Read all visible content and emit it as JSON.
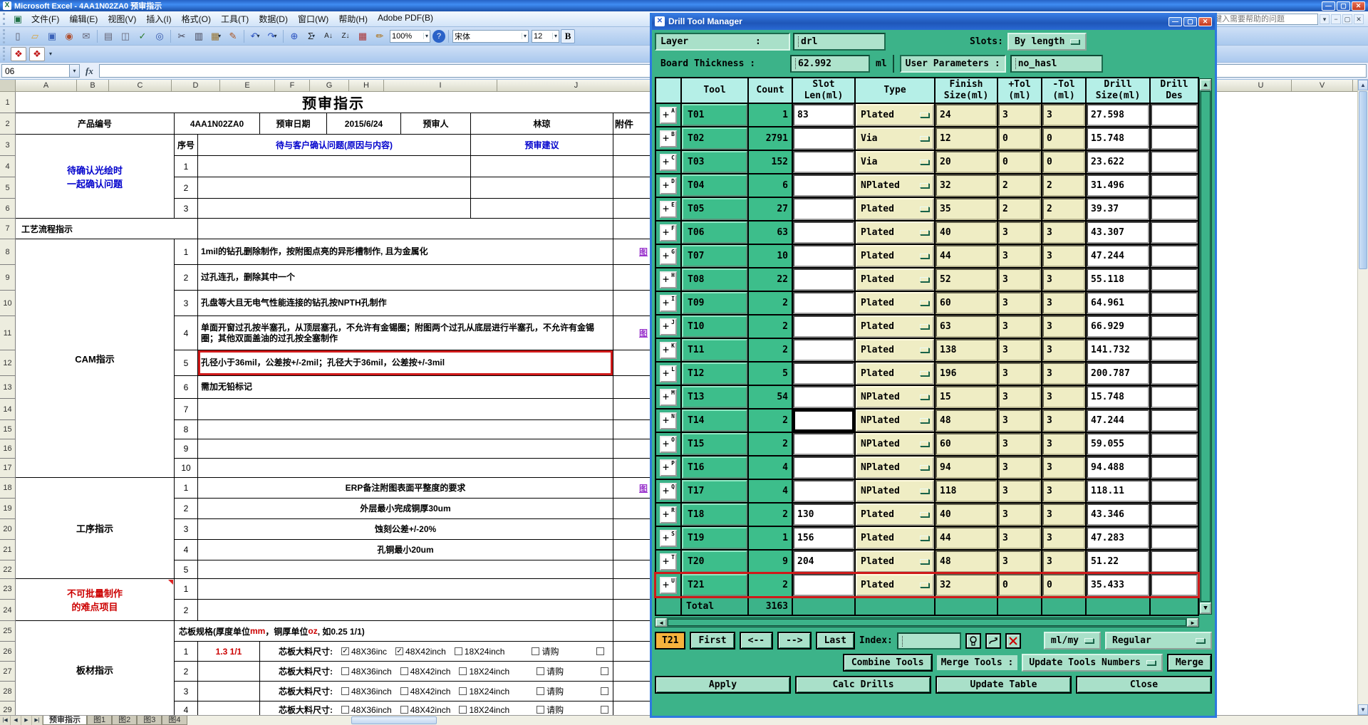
{
  "colors": {
    "dialog_green": "#3cb389",
    "panel_green": "#a9e0c9",
    "header_cyan": "#b5efe7",
    "field_khaki": "#efedc4",
    "highlight_red": "#cf1a1a",
    "current_orange": "#f6b33d",
    "link_blue": "#0000cc",
    "alert_red": "#cc0000",
    "titlebar_blue": "#2663c5"
  },
  "excel": {
    "title_bar": {
      "title": "Microsoft Excel - 4AA1N02ZA0 预审指示"
    },
    "menu_bar": {
      "items": [
        "文件(F)",
        "编辑(E)",
        "视图(V)",
        "插入(I)",
        "格式(O)",
        "工具(T)",
        "数据(D)",
        "窗口(W)",
        "帮助(H)",
        "Adobe PDF(B)"
      ],
      "help_placeholder": "键入需要帮助的问题",
      "window_controls": [
        "−",
        "▢",
        "✕"
      ]
    },
    "toolbar": {
      "zoom_value": "100%",
      "font_name": "宋体",
      "font_size": "12",
      "bold_label": "B",
      "icons": [
        {
          "name": "new-icon",
          "glyph": "▯",
          "color": "#556"
        },
        {
          "name": "open-icon",
          "glyph": "▱",
          "color": "#d9a43a"
        },
        {
          "name": "save-icon",
          "glyph": "▣",
          "color": "#3a62b8"
        },
        {
          "name": "permission-icon",
          "glyph": "◉",
          "color": "#b05030"
        },
        {
          "name": "email-icon",
          "glyph": "✉",
          "color": "#667"
        },
        {
          "sep": true
        },
        {
          "name": "print-icon",
          "glyph": "▤",
          "color": "#667"
        },
        {
          "name": "print-preview-icon",
          "glyph": "◫",
          "color": "#667"
        },
        {
          "name": "spelling-icon",
          "glyph": "✓",
          "color": "#2a7a2a"
        },
        {
          "name": "research-icon",
          "glyph": "◎",
          "color": "#3355aa"
        },
        {
          "sep": true
        },
        {
          "name": "cut-icon",
          "glyph": "✂",
          "color": "#445"
        },
        {
          "name": "copy-icon",
          "glyph": "▥",
          "color": "#445"
        },
        {
          "name": "paste-icon",
          "glyph": "▦",
          "color": "#997633",
          "dd": true
        },
        {
          "name": "format-painter-icon",
          "glyph": "✎",
          "color": "#aa5522"
        },
        {
          "sep": true
        },
        {
          "name": "undo-icon",
          "glyph": "↶",
          "color": "#2a52c0",
          "dd": true
        },
        {
          "name": "redo-icon",
          "glyph": "↷",
          "color": "#2a52c0",
          "dd": true
        },
        {
          "sep": true
        },
        {
          "name": "hyperlink-icon",
          "glyph": "⊕",
          "color": "#2a52c0"
        },
        {
          "name": "autosum-icon",
          "glyph": "Σ",
          "color": "#222",
          "dd": true
        },
        {
          "name": "sort-asc-icon",
          "glyph": "A↓",
          "color": "#222"
        },
        {
          "name": "sort-desc-icon",
          "glyph": "Z↓",
          "color": "#222"
        },
        {
          "name": "chart-wizard-icon",
          "glyph": "▦",
          "color": "#aa3333"
        },
        {
          "name": "drawing-icon",
          "glyph": "✏",
          "color": "#aa6600"
        }
      ],
      "pdf_icons": [
        {
          "name": "convert-to-pdf-icon",
          "glyph": "❖"
        },
        {
          "name": "convert-to-pdf-email-icon",
          "glyph": "❖"
        }
      ]
    },
    "formula_bar": {
      "name_box": "06",
      "fx_label": "fx",
      "formula_value": ""
    },
    "column_headers": [
      "A",
      "B",
      "C",
      "D",
      "E",
      "F",
      "G",
      "H",
      "I",
      "J"
    ],
    "right_column_headers": [
      "U",
      "V"
    ],
    "tab_nav": [
      "|◀",
      "◀",
      "▶",
      "▶|"
    ],
    "tabs": [
      {
        "label": "预审指示",
        "active": true
      },
      {
        "label": "图1",
        "active": false
      },
      {
        "label": "图2",
        "active": false
      },
      {
        "label": "图3",
        "active": false
      },
      {
        "label": "图4",
        "active": false
      }
    ],
    "sheet": {
      "r1_title": "预审指示",
      "r2": {
        "product_label": "产品编号",
        "product_value": "4AA1N02ZA0",
        "date_label": "预审日期",
        "date_value": "2015/6/24",
        "reviewer_label": "预审人",
        "reviewer_value": "林琼",
        "attach_label": "附件"
      },
      "confirm_group": {
        "label1": "待确认光绘时",
        "label2": "一起确认问题",
        "seq_label": "序号",
        "question_header": "待与客户确认问题(原因与内容)",
        "advice_header": "预审建议",
        "seq": [
          "1",
          "2",
          "3"
        ]
      },
      "r7_label": "工艺流程指示",
      "attach_glyph": "图",
      "cam_group": {
        "label": "CAM指示",
        "items": [
          {
            "n": "1",
            "text": "1mil的钻孔删除制作，按附图点亮的异形槽制作, 且为金属化",
            "link": true
          },
          {
            "n": "2",
            "text": "过孔连孔，删除其中一个"
          },
          {
            "n": "3",
            "text": "孔盘等大且无电气性能连接的钻孔按NPTH孔制作"
          },
          {
            "n": "4",
            "text": "单面开窗过孔按半塞孔，从顶层塞孔，不允许有金锡圈；附图两个过孔从底层进行半塞孔，不允许有金锡圈；其他双面盖油的过孔按全塞制作",
            "link": true
          },
          {
            "n": "5",
            "text": "孔径小于36mil，公差按+/-2mil；孔径大于36mil，公差按+/-3mil",
            "boxed": true
          },
          {
            "n": "6",
            "text": "需加无铅标记"
          },
          {
            "n": "7",
            "text": ""
          },
          {
            "n": "8",
            "text": ""
          },
          {
            "n": "9",
            "text": ""
          },
          {
            "n": "10",
            "text": ""
          }
        ]
      },
      "process_group": {
        "label": "工序指示",
        "items": [
          {
            "n": "1",
            "text": "ERP备注附图表面平整度的要求",
            "link": true
          },
          {
            "n": "2",
            "text": "外层最小完成铜厚30um"
          },
          {
            "n": "3",
            "text": "蚀刻公差+/-20%"
          },
          {
            "n": "4",
            "text": "孔铜最小20um"
          },
          {
            "n": "5",
            "text": ""
          }
        ]
      },
      "difficult_group": {
        "label1": "不可批量制作",
        "label2": "的难点项目",
        "items": [
          {
            "n": "1"
          },
          {
            "n": "2"
          }
        ]
      },
      "board_group": {
        "label": "板材指示",
        "header_parts": [
          {
            "t": "芯板规格(厚度单位",
            "red": false
          },
          {
            "t": "mm",
            "red": true
          },
          {
            "t": "，铜厚单位",
            "red": false
          },
          {
            "t": "oz",
            "red": true
          },
          {
            "t": ", 如0.25 1/1)",
            "red": false
          }
        ],
        "rows": [
          {
            "n": "1",
            "value": "1.3 1/1",
            "label": "芯板大料尺寸:",
            "checks": [
              {
                "label": "48X36inc",
                "checked": true
              },
              {
                "label": "48X42inch",
                "checked": true
              },
              {
                "label": "18X24inch",
                "checked": false
              },
              {
                "label": "请购",
                "checked": false
              },
              {
                "label": "",
                "checked": false
              }
            ]
          },
          {
            "n": "2",
            "value": "",
            "label": "芯板大料尺寸:",
            "checks": [
              {
                "label": "48X36inch",
                "checked": false
              },
              {
                "label": "48X42inch",
                "checked": false
              },
              {
                "label": "18X24inch",
                "checked": false
              },
              {
                "label": "请购",
                "checked": false
              },
              {
                "label": "",
                "checked": false
              }
            ]
          },
          {
            "n": "3",
            "value": "",
            "label": "芯板大料尺寸:",
            "checks": [
              {
                "label": "48X36inch",
                "checked": false
              },
              {
                "label": "48X42inch",
                "checked": false
              },
              {
                "label": "18X24inch",
                "checked": false
              },
              {
                "label": "请购",
                "checked": false
              },
              {
                "label": "",
                "checked": false
              }
            ]
          },
          {
            "n": "4",
            "value": "",
            "label": "芯板大料尺寸:",
            "checks": [
              {
                "label": "48X36inch",
                "checked": false
              },
              {
                "label": "48X42inch",
                "checked": false
              },
              {
                "label": "18X24inch",
                "checked": false
              },
              {
                "label": "请购",
                "checked": false
              },
              {
                "label": "",
                "checked": false
              }
            ]
          }
        ]
      }
    }
  },
  "dialog": {
    "title": "Drill Tool Manager",
    "fields": {
      "layer_label": "Layer            :",
      "layer_value": "drl",
      "slots_label": "Slots:",
      "slots_value": "By length",
      "thickness_label": "Board Thickness :",
      "thickness_value": "62.992",
      "thickness_unit": "ml",
      "user_params_label": "User Parameters :",
      "user_params_value": "no_hasl"
    },
    "table": {
      "headers": [
        "",
        "Tool",
        "Count",
        "Slot\nLen(ml)",
        "Type",
        "Finish\nSize(ml)",
        "+Tol\n(ml)",
        "-Tol\n(ml)",
        "Drill\nSize(ml)",
        "Drill\nDes"
      ],
      "rows": [
        {
          "letter": "A",
          "tool": "T01",
          "count": "1",
          "slot": "83",
          "type": "Plated",
          "finish": "24",
          "ptol": "3",
          "ntol": "3",
          "drill": "27.598",
          "des": ""
        },
        {
          "letter": "B",
          "tool": "T02",
          "count": "2791",
          "slot": "",
          "type": "Via",
          "finish": "12",
          "ptol": "0",
          "ntol": "0",
          "drill": "15.748",
          "des": ""
        },
        {
          "letter": "C",
          "tool": "T03",
          "count": "152",
          "slot": "",
          "type": "Via",
          "finish": "20",
          "ptol": "0",
          "ntol": "0",
          "drill": "23.622",
          "des": ""
        },
        {
          "letter": "D",
          "tool": "T04",
          "count": "6",
          "slot": "",
          "type": "NPlated",
          "finish": "32",
          "ptol": "2",
          "ntol": "2",
          "drill": "31.496",
          "des": ""
        },
        {
          "letter": "E",
          "tool": "T05",
          "count": "27",
          "slot": "",
          "type": "Plated",
          "finish": "35",
          "ptol": "2",
          "ntol": "2",
          "drill": "39.37",
          "des": ""
        },
        {
          "letter": "F",
          "tool": "T06",
          "count": "63",
          "slot": "",
          "type": "Plated",
          "finish": "40",
          "ptol": "3",
          "ntol": "3",
          "drill": "43.307",
          "des": ""
        },
        {
          "letter": "G",
          "tool": "T07",
          "count": "10",
          "slot": "",
          "type": "Plated",
          "finish": "44",
          "ptol": "3",
          "ntol": "3",
          "drill": "47.244",
          "des": ""
        },
        {
          "letter": "H",
          "tool": "T08",
          "count": "22",
          "slot": "",
          "type": "Plated",
          "finish": "52",
          "ptol": "3",
          "ntol": "3",
          "drill": "55.118",
          "des": ""
        },
        {
          "letter": "I",
          "tool": "T09",
          "count": "2",
          "slot": "",
          "type": "Plated",
          "finish": "60",
          "ptol": "3",
          "ntol": "3",
          "drill": "64.961",
          "des": ""
        },
        {
          "letter": "J",
          "tool": "T10",
          "count": "2",
          "slot": "",
          "type": "Plated",
          "finish": "63",
          "ptol": "3",
          "ntol": "3",
          "drill": "66.929",
          "des": ""
        },
        {
          "letter": "K",
          "tool": "T11",
          "count": "2",
          "slot": "",
          "type": "Plated",
          "finish": "138",
          "ptol": "3",
          "ntol": "3",
          "drill": "141.732",
          "des": ""
        },
        {
          "letter": "L",
          "tool": "T12",
          "count": "5",
          "slot": "",
          "type": "Plated",
          "finish": "196",
          "ptol": "3",
          "ntol": "3",
          "drill": "200.787",
          "des": ""
        },
        {
          "letter": "M",
          "tool": "T13",
          "count": "54",
          "slot": "",
          "type": "NPlated",
          "finish": "15",
          "ptol": "3",
          "ntol": "3",
          "drill": "15.748",
          "des": ""
        },
        {
          "letter": "N",
          "tool": "T14",
          "count": "2",
          "slot": "",
          "type": "NPlated",
          "finish": "48",
          "ptol": "3",
          "ntol": "3",
          "drill": "47.244",
          "des": "",
          "focused": true
        },
        {
          "letter": "O",
          "tool": "T15",
          "count": "2",
          "slot": "",
          "type": "NPlated",
          "finish": "60",
          "ptol": "3",
          "ntol": "3",
          "drill": "59.055",
          "des": ""
        },
        {
          "letter": "P",
          "tool": "T16",
          "count": "4",
          "slot": "",
          "type": "NPlated",
          "finish": "94",
          "ptol": "3",
          "ntol": "3",
          "drill": "94.488",
          "des": ""
        },
        {
          "letter": "Q",
          "tool": "T17",
          "count": "4",
          "slot": "",
          "type": "NPlated",
          "finish": "118",
          "ptol": "3",
          "ntol": "3",
          "drill": "118.11",
          "des": ""
        },
        {
          "letter": "R",
          "tool": "T18",
          "count": "2",
          "slot": "130",
          "type": "Plated",
          "finish": "40",
          "ptol": "3",
          "ntol": "3",
          "drill": "43.346",
          "des": ""
        },
        {
          "letter": "S",
          "tool": "T19",
          "count": "1",
          "slot": "156",
          "type": "Plated",
          "finish": "44",
          "ptol": "3",
          "ntol": "3",
          "drill": "47.283",
          "des": ""
        },
        {
          "letter": "T",
          "tool": "T20",
          "count": "9",
          "slot": "204",
          "type": "Plated",
          "finish": "48",
          "ptol": "3",
          "ntol": "3",
          "drill": "51.22",
          "des": ""
        },
        {
          "letter": "U",
          "tool": "T21",
          "count": "2",
          "slot": "",
          "type": "Plated",
          "finish": "32",
          "ptol": "0",
          "ntol": "0",
          "drill": "35.433",
          "des": "",
          "highlight": true
        }
      ],
      "total_label": "Total",
      "total_count": "3163"
    },
    "nav": {
      "current": "T21",
      "first": "First",
      "prev": "<--",
      "next": "-->",
      "last": "Last",
      "index_label": "Index:",
      "index_value": "",
      "units_value": "ml/my",
      "mode_value": "Regular"
    },
    "actions": {
      "combine": "Combine Tools",
      "merge_tools_label": "Merge Tools :",
      "update_numbers": "Update Tools Numbers",
      "merge": "Merge",
      "apply": "Apply",
      "calc": "Calc Drills",
      "update_table": "Update Table",
      "close": "Close"
    }
  }
}
